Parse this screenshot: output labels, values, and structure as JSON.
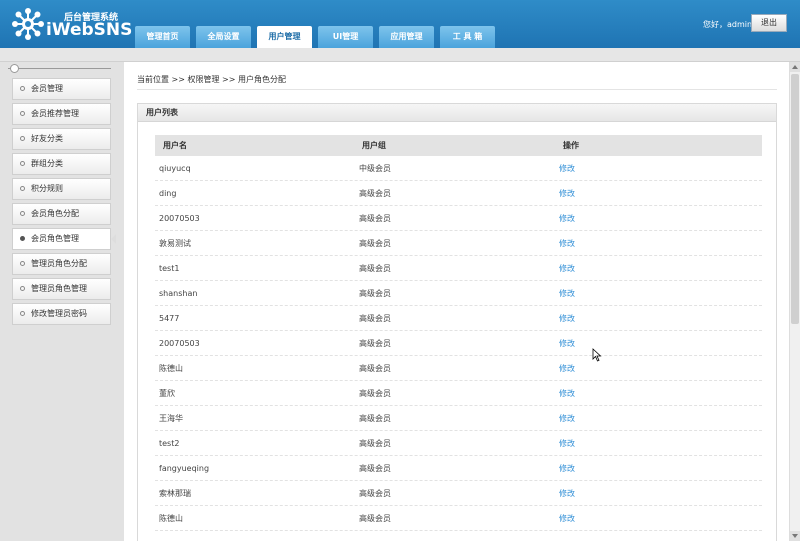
{
  "header": {
    "brand_sub": "后台管理系统",
    "brand_name": "iWebSNS",
    "greeting": "您好，admin",
    "logout_label": "退出",
    "brand_color": "#2a84c2"
  },
  "nav": {
    "tabs": [
      {
        "label": "管理首页",
        "active": false
      },
      {
        "label": "全局设置",
        "active": false
      },
      {
        "label": "用户管理",
        "active": true
      },
      {
        "label": "UI管理",
        "active": false
      },
      {
        "label": "应用管理",
        "active": false
      },
      {
        "label": "工 具 箱",
        "active": false
      }
    ]
  },
  "sidebar": {
    "items": [
      {
        "label": "会员管理"
      },
      {
        "label": "会员推荐管理"
      },
      {
        "label": "好友分类"
      },
      {
        "label": "群组分类"
      },
      {
        "label": "积分规则"
      },
      {
        "label": "会员角色分配"
      },
      {
        "label": "会员角色管理",
        "active": true
      },
      {
        "label": "管理员角色分配"
      },
      {
        "label": "管理员角色管理"
      },
      {
        "label": "修改管理员密码"
      }
    ]
  },
  "breadcrumb": {
    "text": "当前位置 >> 权限管理 >> 用户角色分配"
  },
  "panel": {
    "title": "用户列表",
    "columns": [
      "用户名",
      "用户组",
      "操作"
    ],
    "rows": [
      {
        "name": "qiuyucq",
        "group": "中级会员",
        "action": "修改"
      },
      {
        "name": "ding",
        "group": "高级会员",
        "action": "修改"
      },
      {
        "name": "20070503",
        "group": "高级会员",
        "action": "修改"
      },
      {
        "name": "敦易测试",
        "group": "高级会员",
        "action": "修改"
      },
      {
        "name": "test1",
        "group": "高级会员",
        "action": "修改"
      },
      {
        "name": "shanshan",
        "group": "高级会员",
        "action": "修改"
      },
      {
        "name": "5477",
        "group": "高级会员",
        "action": "修改"
      },
      {
        "name": "20070503",
        "group": "高级会员",
        "action": "修改"
      },
      {
        "name": "陈德山",
        "group": "高级会员",
        "action": "修改"
      },
      {
        "name": "董欣",
        "group": "高级会员",
        "action": "修改"
      },
      {
        "name": "王海华",
        "group": "高级会员",
        "action": "修改"
      },
      {
        "name": "test2",
        "group": "高级会员",
        "action": "修改"
      },
      {
        "name": "fangyueqing",
        "group": "高级会员",
        "action": "修改"
      },
      {
        "name": "索林那瑞",
        "group": "高级会员",
        "action": "修改"
      },
      {
        "name": "陈德山",
        "group": "高级会员",
        "action": "修改"
      }
    ]
  },
  "colors": {
    "link": "#2f8ed6",
    "header_bg": "#2a84c2",
    "sidebar_bg": "#e2e2e2"
  }
}
